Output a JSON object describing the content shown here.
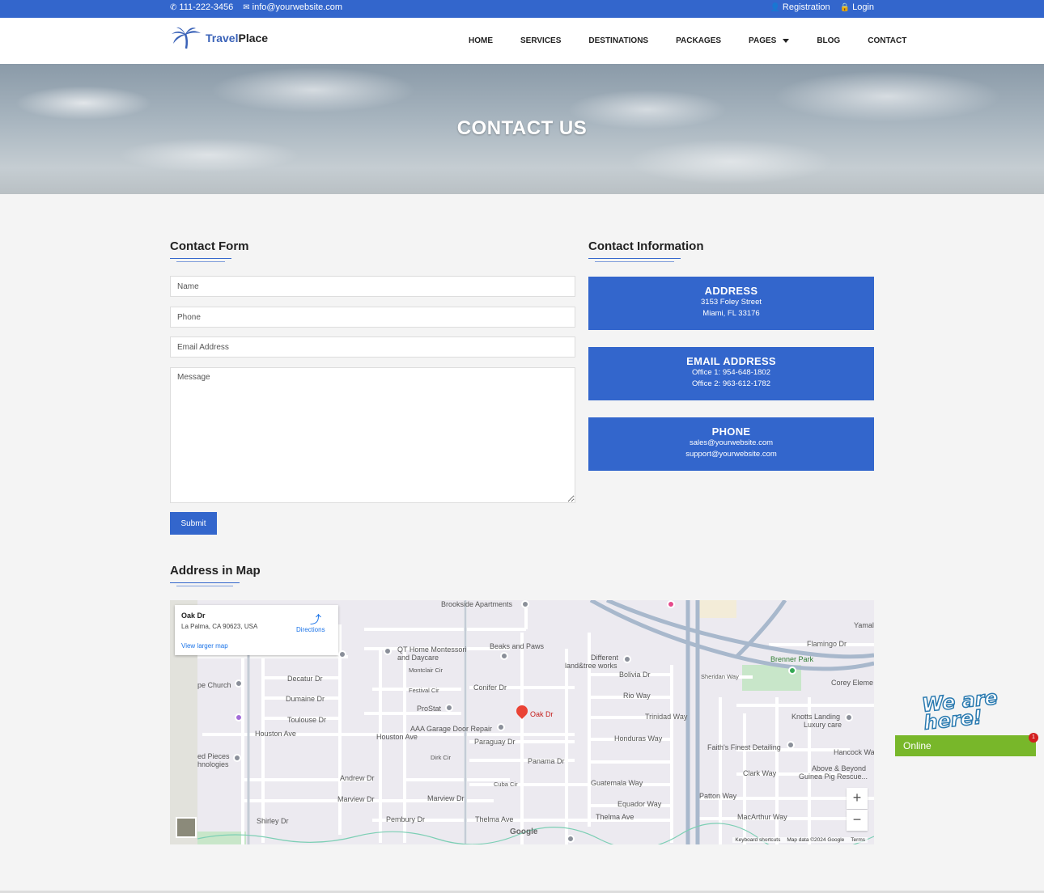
{
  "topbar": {
    "phone": "111-222-3456",
    "email": "info@yourwebsite.com",
    "registration": "Registration",
    "login": "Login"
  },
  "brand": {
    "name_part1": "Travel",
    "name_part2": "Place"
  },
  "menu": {
    "home": "HOME",
    "services": "SERVICES",
    "destinations": "DESTINATIONS",
    "packages": "PACKAGES",
    "pages": "PAGES",
    "blog": "BLOG",
    "contact": "CONTACT"
  },
  "hero": {
    "title": "CONTACT US"
  },
  "contact_form": {
    "title": "Contact Form",
    "name_placeholder": "Name",
    "phone_placeholder": "Phone",
    "email_placeholder": "Email Address",
    "message_placeholder": "Message",
    "submit_label": "Submit"
  },
  "contact_info": {
    "title": "Contact Information",
    "address": {
      "heading": "ADDRESS",
      "line1": "3153 Foley Street",
      "line2": "Miami, FL 33176"
    },
    "email": {
      "heading": "EMAIL ADDRESS",
      "line1": "Office 1: 954-648-1802",
      "line2": "Office 2: 963-612-1782"
    },
    "phone": {
      "heading": "PHONE",
      "line1": "sales@yourwebsite.com",
      "line2": "support@yourwebsite.com"
    }
  },
  "map": {
    "title": "Address in Map",
    "place_name": "Oak Dr",
    "place_address": "La Palma, CA 90623, USA",
    "directions": "Directions",
    "view_larger": "View larger map",
    "pin_label": "Oak Dr",
    "zoom_in": "+",
    "zoom_out": "−",
    "footer": {
      "shortcuts": "Keyboard shortcuts",
      "data": "Map data ©2024 Google",
      "terms": "Terms"
    },
    "google": "Google",
    "labels": {
      "brookside": "Brookside Apartments",
      "qt_home": "QT Home Montessori",
      "qt_home2": "and Daycare",
      "beaks": "Beaks and Paws",
      "different": "Different",
      "landtree": "land&tree works",
      "bolivia": "Bolivia Dr",
      "decatur": "Decatur Dr",
      "dumaine": "Dumaine Dr",
      "toulouse": "Toulouse Dr",
      "church": "pe Church",
      "montclair": "Montclair Cir",
      "festival": "Festival Cir",
      "conifer": "Conifer Dr",
      "prostat": "ProStat",
      "aaa": "AAA Garage Door Repair",
      "houston1": "Houston Ave",
      "houston2": "Houston Ave",
      "paraguay": "Paraguay Dr",
      "rio": "Rio Way",
      "trinidad": "Trinidad Way",
      "honduras": "Honduras Way",
      "panama": "Panama Dr",
      "dirk": "Dirk Cir",
      "andrew": "Andrew Dr",
      "cuba": "Cuba Cir",
      "guatemala": "Guatemala Way",
      "equador": "Equador Way",
      "marview1": "Marview Dr",
      "marview2": "Marview Dr",
      "pembury": "Pembury Dr",
      "thelma1": "Thelma Ave",
      "thelma2": "Thelma Ave",
      "shirley": "Shirley Dr",
      "flamingo": "Flamingo Dr",
      "brenner": "Brenner Park",
      "sheridan": "Sheridan Way",
      "corey": "Corey Eleme",
      "knotts": "Knotts Landing",
      "knotts2": "Luxury care",
      "faiths": "Faith's Finest Detailing",
      "hancock": "Hancock Wa",
      "clark": "Clark Way",
      "above": "Above & Beyond",
      "above2": "Guinea Pig Rescue...",
      "patton": "Patton Way",
      "macarthur": "MacArthur Way",
      "pieces": "ed Pieces",
      "pieces2": "hnologies",
      "yamal": "Yamal"
    }
  },
  "chat": {
    "headline": "We are here!",
    "status": "Online",
    "count": "1"
  },
  "colors": {
    "brand_blue": "#3366cc",
    "online_green": "#78b72a"
  }
}
